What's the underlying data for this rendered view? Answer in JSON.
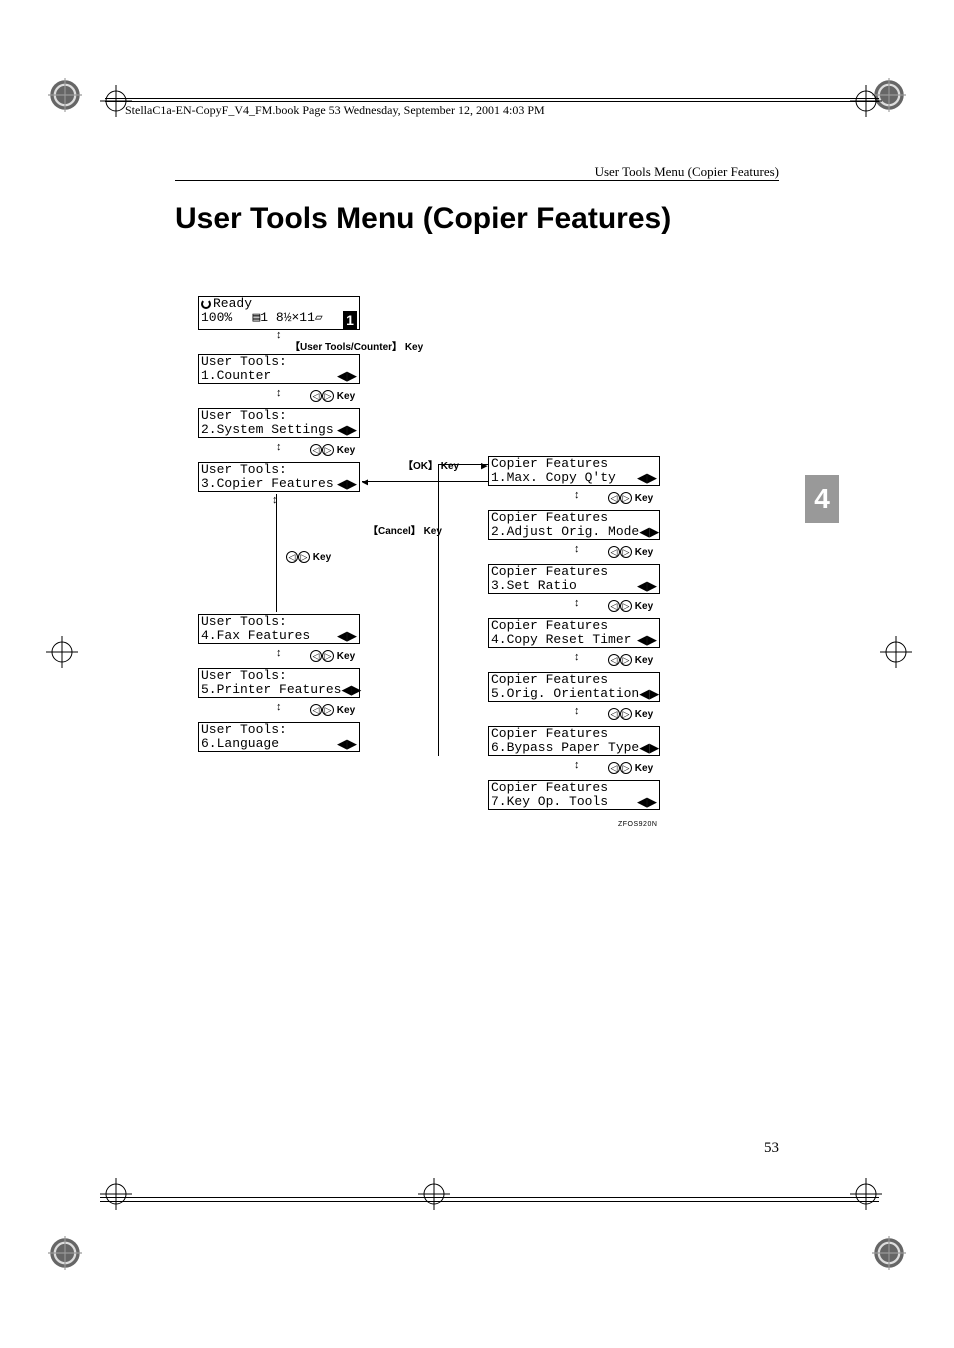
{
  "header_text": "StellaC1a-EN-CopyF_V4_FM.book  Page 53  Wednesday, September 12, 2001  4:03 PM",
  "running_head": "User Tools Menu (Copier Features)",
  "page_title": "User Tools Menu (Copier Features)",
  "chapter_number": "4",
  "page_number": "53",
  "image_code": "ZFOS920N",
  "ready_status": "Ready",
  "ready_pct": "100%",
  "ready_paper": "8½×11",
  "ready_count": "1",
  "key_user_tools": "【User Tools/Counter】 Key",
  "key_nav": "Key",
  "key_ok": "【OK】 Key",
  "key_cancel": "【Cancel】 Key",
  "left_boxes": [
    {
      "title": "User Tools:",
      "item": "1.Counter"
    },
    {
      "title": "User Tools:",
      "item": "2.System Settings"
    },
    {
      "title": "User Tools:",
      "item": "3.Copier Features"
    },
    {
      "title": "User Tools:",
      "item": "4.Fax Features"
    },
    {
      "title": "User Tools:",
      "item": "5.Printer Features"
    },
    {
      "title": "User Tools:",
      "item": "6.Language"
    }
  ],
  "right_boxes": [
    {
      "title": "Copier Features",
      "item": "1.Max. Copy Q'ty"
    },
    {
      "title": "Copier Features",
      "item": "2.Adjust Orig. Mode"
    },
    {
      "title": "Copier Features",
      "item": "3.Set Ratio"
    },
    {
      "title": "Copier Features",
      "item": "4.Copy Reset Timer"
    },
    {
      "title": "Copier Features",
      "item": "5.Orig. Orientation"
    },
    {
      "title": "Copier Features",
      "item": "6.Bypass Paper Type"
    },
    {
      "title": "Copier Features",
      "item": "7.Key Op. Tools"
    }
  ]
}
